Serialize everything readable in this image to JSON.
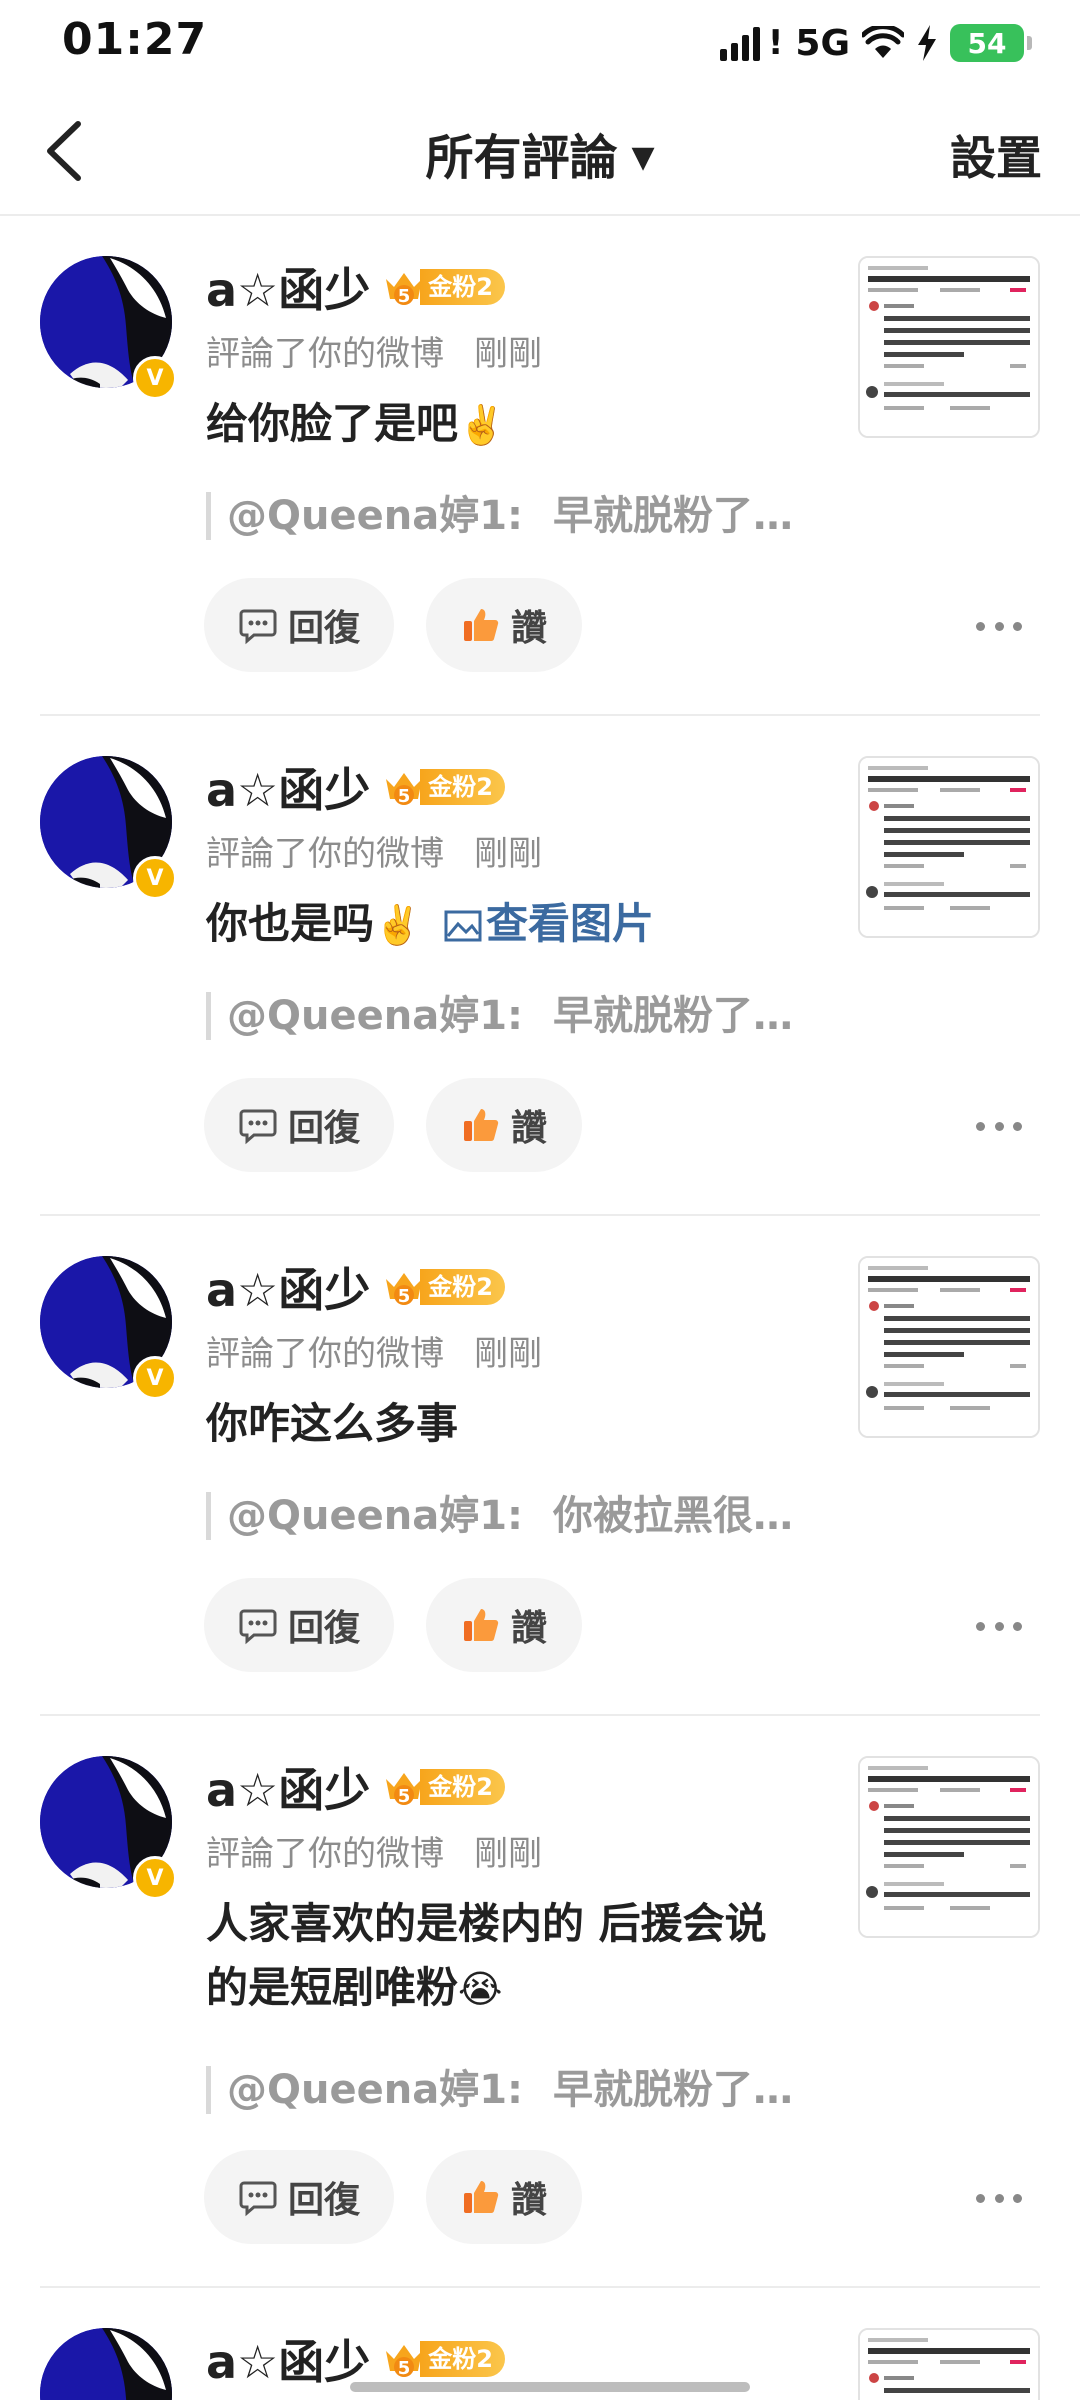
{
  "status_bar": {
    "time": "01:27",
    "network": "5G",
    "battery": "54"
  },
  "nav": {
    "title": "所有評論",
    "settings": "設置"
  },
  "comments": [
    {
      "username": "a☆函少",
      "fan_label": "金粉2",
      "fan_level": "5",
      "verified_badge": "V",
      "action": "評論了你的微博",
      "time": "剛剛",
      "content": "给你脸了是吧",
      "emoji": "✌️",
      "view_image": "",
      "quote_user": "@Queena婷1:",
      "quote_text": "早就脱粉了…",
      "reply_label": "回復",
      "like_label": "讚"
    },
    {
      "username": "a☆函少",
      "fan_label": "金粉2",
      "fan_level": "5",
      "verified_badge": "V",
      "action": "評論了你的微博",
      "time": "剛剛",
      "content": "你也是吗",
      "emoji": "✌️",
      "view_image": "查看图片",
      "quote_user": "@Queena婷1:",
      "quote_text": "早就脱粉了…",
      "reply_label": "回復",
      "like_label": "讚"
    },
    {
      "username": "a☆函少",
      "fan_label": "金粉2",
      "fan_level": "5",
      "verified_badge": "V",
      "action": "評論了你的微博",
      "time": "剛剛",
      "content": "你咋这么多事",
      "emoji": "",
      "view_image": "",
      "quote_user": "@Queena婷1:",
      "quote_text": "你被拉黑很…",
      "reply_label": "回復",
      "like_label": "讚"
    },
    {
      "username": "a☆函少",
      "fan_label": "金粉2",
      "fan_level": "5",
      "verified_badge": "V",
      "action": "評論了你的微博",
      "time": "剛剛",
      "content": "人家喜欢的是楼内的  后援会说的是短剧唯粉",
      "emoji": "😭",
      "view_image": "",
      "quote_user": "@Queena婷1:",
      "quote_text": "早就脱粉了…",
      "reply_label": "回復",
      "like_label": "讚"
    },
    {
      "username": "a☆函少",
      "fan_label": "金粉2",
      "fan_level": "5",
      "verified_badge": "",
      "action": "",
      "time": "",
      "content": "",
      "emoji": "",
      "view_image": "",
      "quote_user": "",
      "quote_text": "",
      "reply_label": "",
      "like_label": ""
    }
  ],
  "colors": {
    "accent_orange": "#f7a51c",
    "link_blue": "#3b6aa0",
    "like_orange": "#f06d22",
    "verified_gold": "#f7b500"
  },
  "icons": [
    "back-chevron-icon",
    "caret-down-icon",
    "comment-icon",
    "thumbs-up-icon",
    "more-dots-icon",
    "crown-icon",
    "image-icon"
  ]
}
